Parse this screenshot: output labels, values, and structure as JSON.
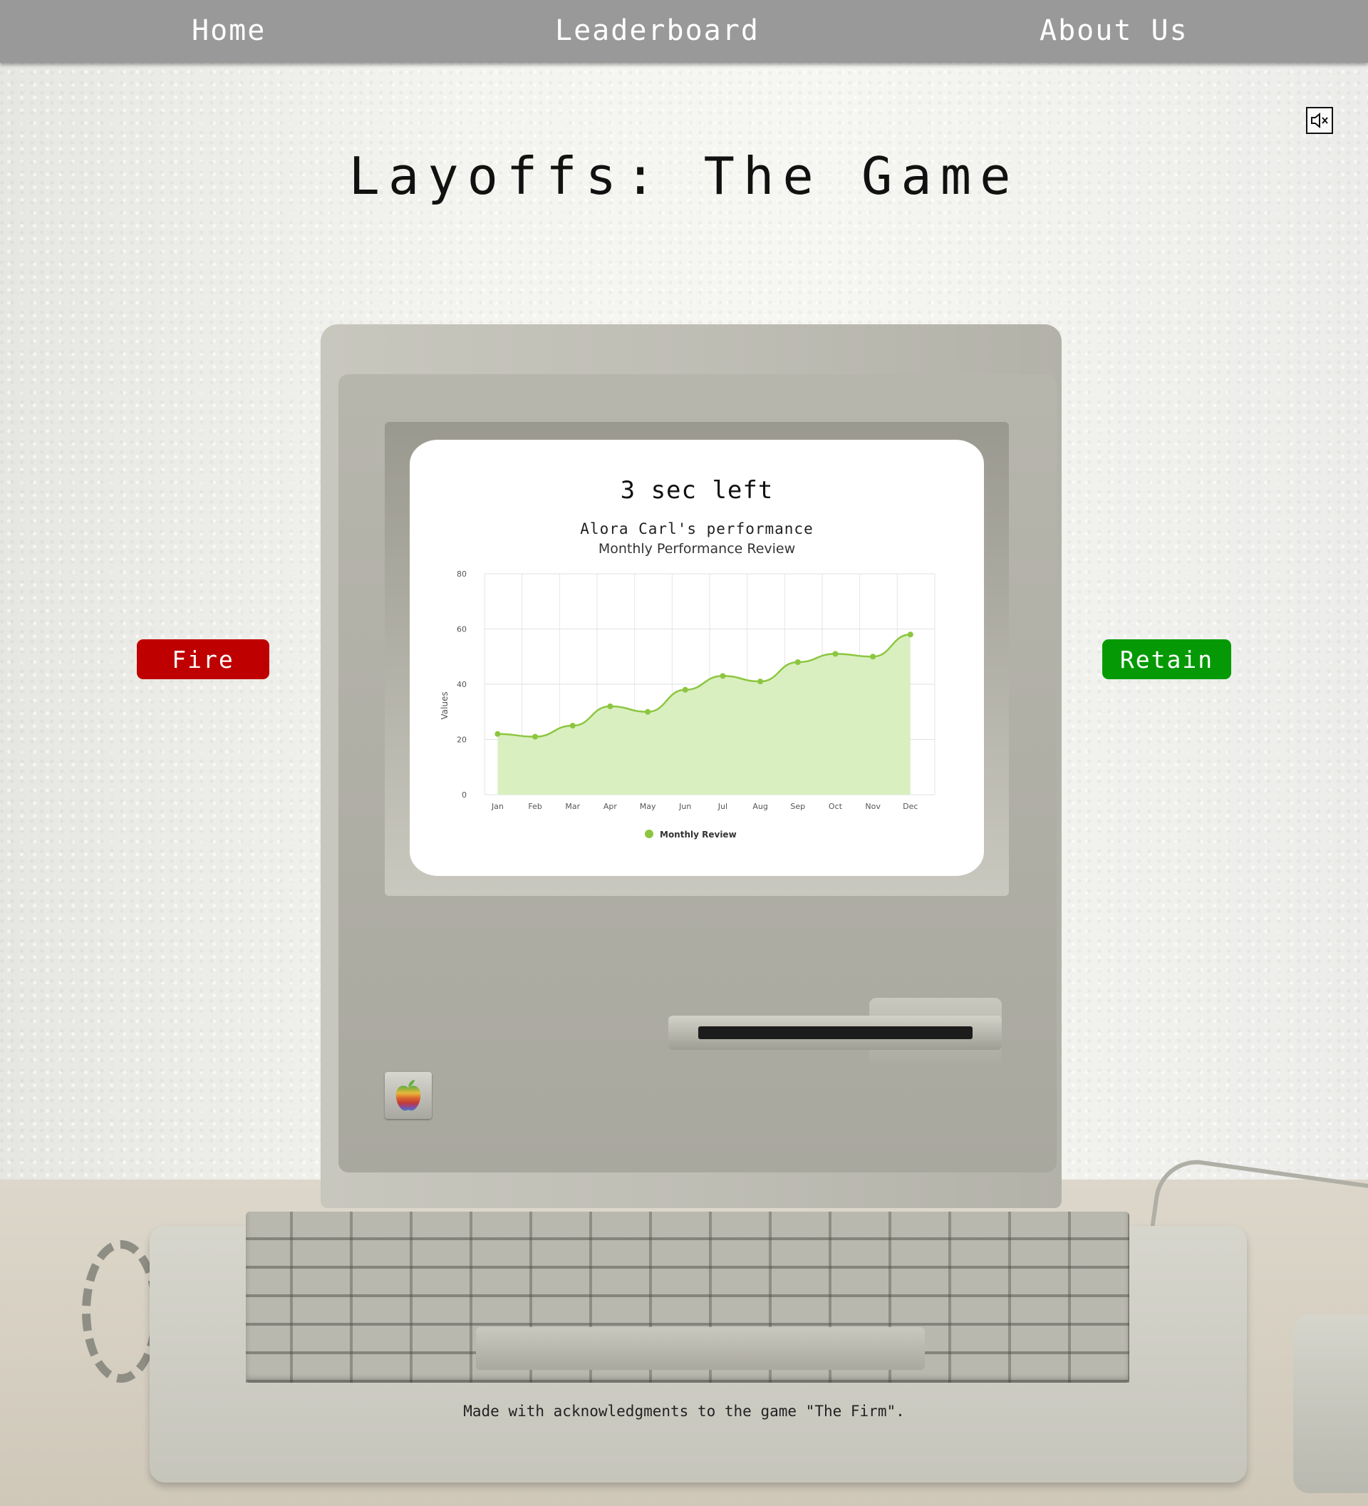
{
  "nav": {
    "home": "Home",
    "leaderboard": "Leaderboard",
    "about": "About Us"
  },
  "sound": {
    "icon": "speaker-muted-icon"
  },
  "page_title": "Layoffs: The Game",
  "game": {
    "timer": "3 sec left",
    "employee_caption": "Alora Carl's performance",
    "fire_label": "Fire",
    "retain_label": "Retain"
  },
  "colors": {
    "nav": "#999999",
    "fire": "#bf0000",
    "retain": "#059a05",
    "series_line": "#8cc63f",
    "series_fill": "#d9efc0"
  },
  "chart_data": {
    "type": "area",
    "title": "Monthly Performance Review",
    "xlabel": "",
    "ylabel": "Values",
    "categories": [
      "Jan",
      "Feb",
      "Mar",
      "Apr",
      "May",
      "Jun",
      "Jul",
      "Aug",
      "Sep",
      "Oct",
      "Nov",
      "Dec"
    ],
    "series": [
      {
        "name": "Monthly Review",
        "values": [
          22,
          21,
          25,
          32,
          30,
          38,
          43,
          41,
          48,
          51,
          50,
          58
        ]
      }
    ],
    "ylim": [
      0,
      80
    ],
    "yticks": [
      0,
      20,
      40,
      60,
      80
    ],
    "grid": true,
    "legend": "bottom"
  },
  "footer": "Made with acknowledgments to the game \"The Firm\"."
}
